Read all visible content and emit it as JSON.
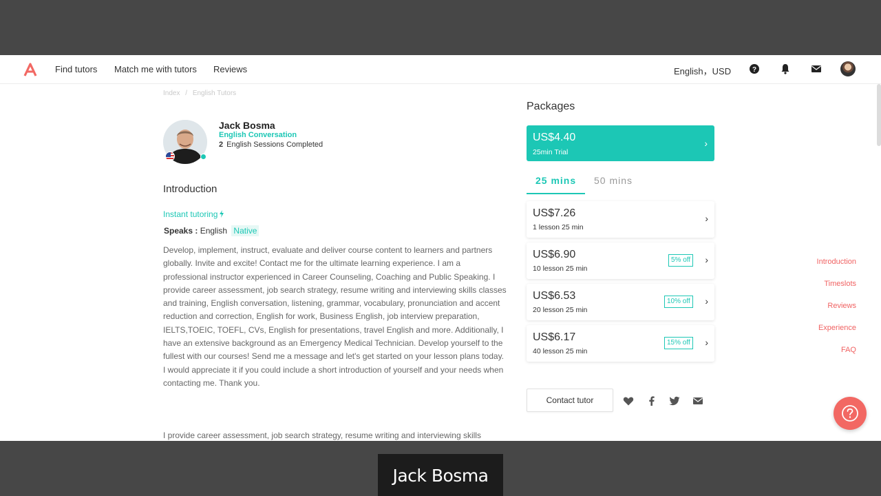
{
  "nav": {
    "links": [
      "Find tutors",
      "Match me with tutors",
      "Reviews"
    ],
    "language_currency": "English，USD",
    "icons": [
      "help-icon",
      "bell-icon",
      "mail-icon",
      "avatar"
    ]
  },
  "breadcrumb": [
    "Index",
    "/",
    "English Tutors"
  ],
  "tutor": {
    "name": "Jack Bosma",
    "subject": "English Conversation",
    "sessions_count": "2",
    "sessions_label": "English Sessions Completed"
  },
  "intro": {
    "title": "Introduction",
    "instant": "Instant tutoring",
    "speaks_label": "Speaks :",
    "speaks_lang": "English",
    "speaks_level": "Native",
    "bio": "Develop, implement, instruct, evaluate and deliver course content to learners and partners globally. Invite and excite! Contact me for the ultimate learning experience. I am a professional instructor experienced in Career Counseling, Coaching and Public Speaking. I provide career assessment, job search strategy, resume writing and interviewing skills classes and training, English conversation,  listening, grammar, vocabulary, pronunciation and accent reduction and correction, English for work, Business English, job interview preparation, IELTS,TOEIC, TOEFL, CVs, English for presentations, travel English and more. Additionally, I have an extensive background as an Emergency Medical Technician. Develop yourself to the fullest with  our courses! Send me a message and let's get started on your lesson plans today. I would appreciate it if you could include a short introduction of yourself and your needs when contacting me. Thank you.",
    "bio2": "I provide career assessment, job search strategy, resume writing and interviewing skills"
  },
  "packages": {
    "title": "Packages",
    "trial": {
      "price": "US$4.40",
      "desc": "25min Trial"
    },
    "tabs": [
      "25 mins",
      "50 mins"
    ],
    "active_tab": "25 mins",
    "items": [
      {
        "price": "US$7.26",
        "desc": "1 lesson 25 min",
        "badge": ""
      },
      {
        "price": "US$6.90",
        "desc": "10 lesson 25 min",
        "badge": "5% off"
      },
      {
        "price": "US$6.53",
        "desc": "20 lesson 25 min",
        "badge": "10% off"
      },
      {
        "price": "US$6.17",
        "desc": "40 lesson 25 min",
        "badge": "15% off"
      }
    ],
    "contact_label": "Contact tutor",
    "social_icons": [
      "heart-icon",
      "facebook-icon",
      "twitter-icon",
      "mail-icon"
    ]
  },
  "side_nav": [
    "Introduction",
    "Timeslots",
    "Reviews",
    "Experience",
    "FAQ"
  ],
  "caption": "Jack Bosma",
  "colors": {
    "accent": "#1cc7b5",
    "side_link": "#f06262",
    "fab": "#f26863"
  }
}
